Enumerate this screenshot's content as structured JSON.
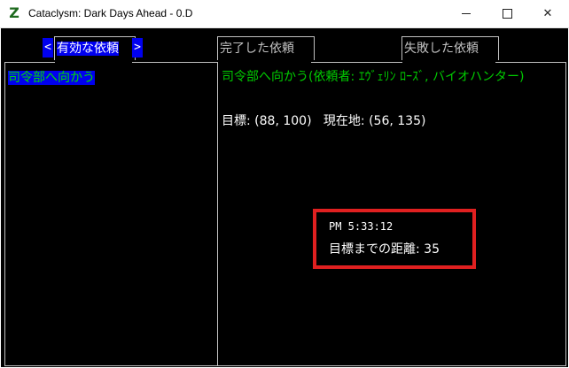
{
  "window": {
    "app_icon": "Z",
    "title": "Cataclysm: Dark Days Ahead - 0.D",
    "controls": {
      "minimize_icon": "minimize-icon",
      "maximize_icon": "maximize-icon",
      "close_icon": "close-icon",
      "close_glyph": "✕"
    }
  },
  "colors": {
    "console_bg": "#000000",
    "highlight": "#0000ee",
    "mission_green": "#00cc00",
    "annotation_red": "#e02020"
  },
  "tabs": {
    "prev_arrow": "<",
    "next_arrow": ">",
    "active": "有効な依頼",
    "completed": "完了した依頼",
    "failed": "失敗した依頼"
  },
  "missions": [
    {
      "name": "司令部へ向かう"
    }
  ],
  "detail": {
    "title": "司令部へ向かう(依頼者: ｴｳﾞｪﾘﾝ ﾛｰｽﾞ, バイオハンター)",
    "target_label": "目標:",
    "target_coords": "(88, 100)",
    "current_label": "現在地:",
    "current_coords": "(56, 135)"
  },
  "overlay": {
    "time": "PM 5:33:12",
    "distance_label": "目標までの距離:",
    "distance_value": "35"
  }
}
